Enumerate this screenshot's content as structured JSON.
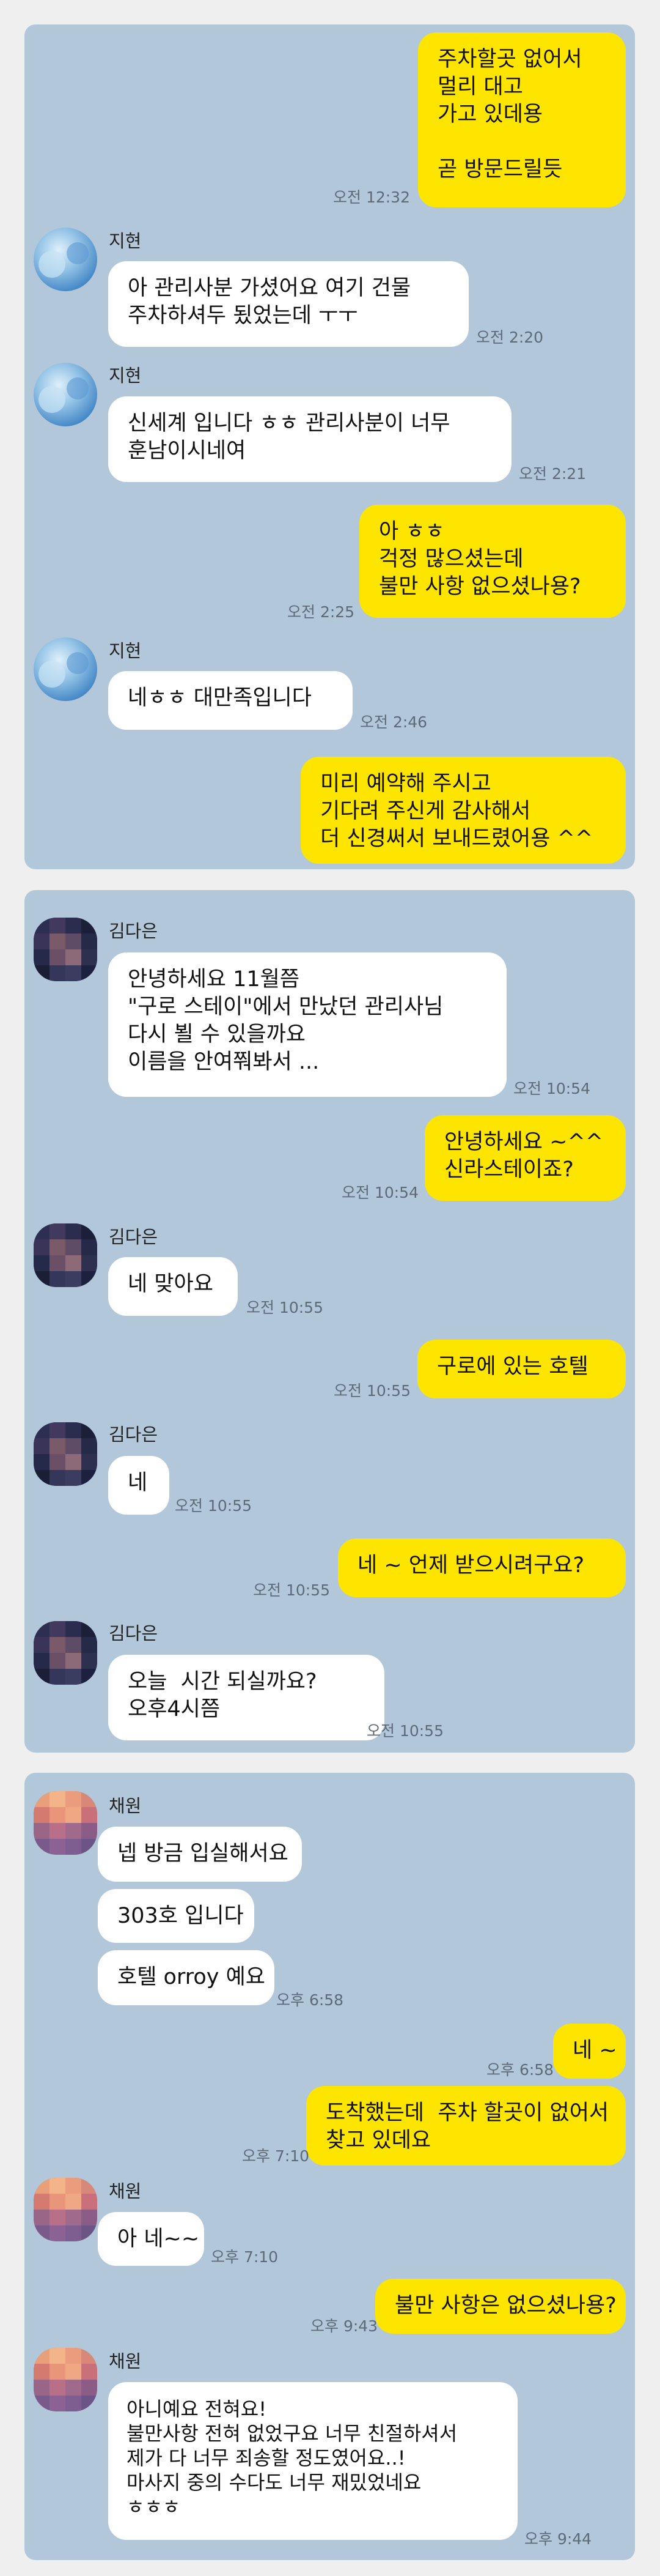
{
  "colors": {
    "chat_background": "#b2c7d9",
    "my_bubble": "#fee500",
    "other_bubble": "#ffffff",
    "page_background": "#efefef"
  },
  "chat1": {
    "messages": [
      {
        "text": "주차할곳 없어서\n멀리 대고\n가고 있데용\n\n곧 방문드릴듯",
        "time": "오전 12:32"
      },
      {
        "sender": "지현",
        "text": "아 관리사분 가셨어요 여기 건물\n주차하셔두 됬었는데 ㅜㅜ",
        "time": "오전 2:20"
      },
      {
        "sender": "지현",
        "text": "신세계 입니다 ㅎㅎ 관리사분이 너무\n훈남이시네여",
        "time": "오전 2:21"
      },
      {
        "text": "아 ㅎㅎ\n걱정 많으셨는데\n불만 사항 없으셨나용?",
        "time": "오전 2:25"
      },
      {
        "sender": "지현",
        "text": "네ㅎㅎ 대만족입니다",
        "time": "오전 2:46"
      },
      {
        "text": "미리 예약해 주시고\n기다려 주신게 감사해서\n더 신경써서 보내드렸어용 ^^"
      }
    ]
  },
  "chat2": {
    "messages": [
      {
        "sender": "김다은",
        "text": "안녕하세요 11월쯤\n\"구로 스테이\"에서 만났던 관리사님\n다시 뵐 수 있을까요\n이름을 안여쭤봐서 ...",
        "time": "오전 10:54"
      },
      {
        "text": "안녕하세요 ~^^\n신라스테이죠?",
        "time": "오전 10:54"
      },
      {
        "sender": "김다은",
        "text": "네 맞아요",
        "time": "오전 10:55"
      },
      {
        "text": "구로에 있는 호텔",
        "time": "오전 10:55"
      },
      {
        "sender": "김다은",
        "text": "네",
        "time": "오전 10:55"
      },
      {
        "text": "네 ~ 언제 받으시려구요?",
        "time": "오전 10:55"
      },
      {
        "sender": "김다은",
        "text": "오늘  시간 되실까요?\n오후4시쯤",
        "time": "오전 10:55"
      }
    ]
  },
  "chat3": {
    "messages": [
      {
        "sender": "채원",
        "text": "넵 방금 입실해서요"
      },
      {
        "text": "303호 입니다"
      },
      {
        "text": "호텔 orroy 예요",
        "time": "오후 6:58"
      },
      {
        "text": "네 ~",
        "time": "오후 6:58"
      },
      {
        "text": "도착했는데  주차 할곳이 없어서\n찾고 있데요",
        "time": "오후 7:10"
      },
      {
        "sender": "채원",
        "text": "아 네~~",
        "time": "오후 7:10"
      },
      {
        "text": "불만 사항은 없으셨나용?",
        "time": "오후 9:43"
      },
      {
        "sender": "채원",
        "text": "아니예요 전혀요!\n불만사항 전혀 없었구요 너무 친절하셔서\n제가 다 너무 죄송할 정도였어요..!\n마사지 중의 수다도 너무 재밌었네요\nㅎㅎㅎ",
        "time": "오후 9:44"
      }
    ]
  }
}
